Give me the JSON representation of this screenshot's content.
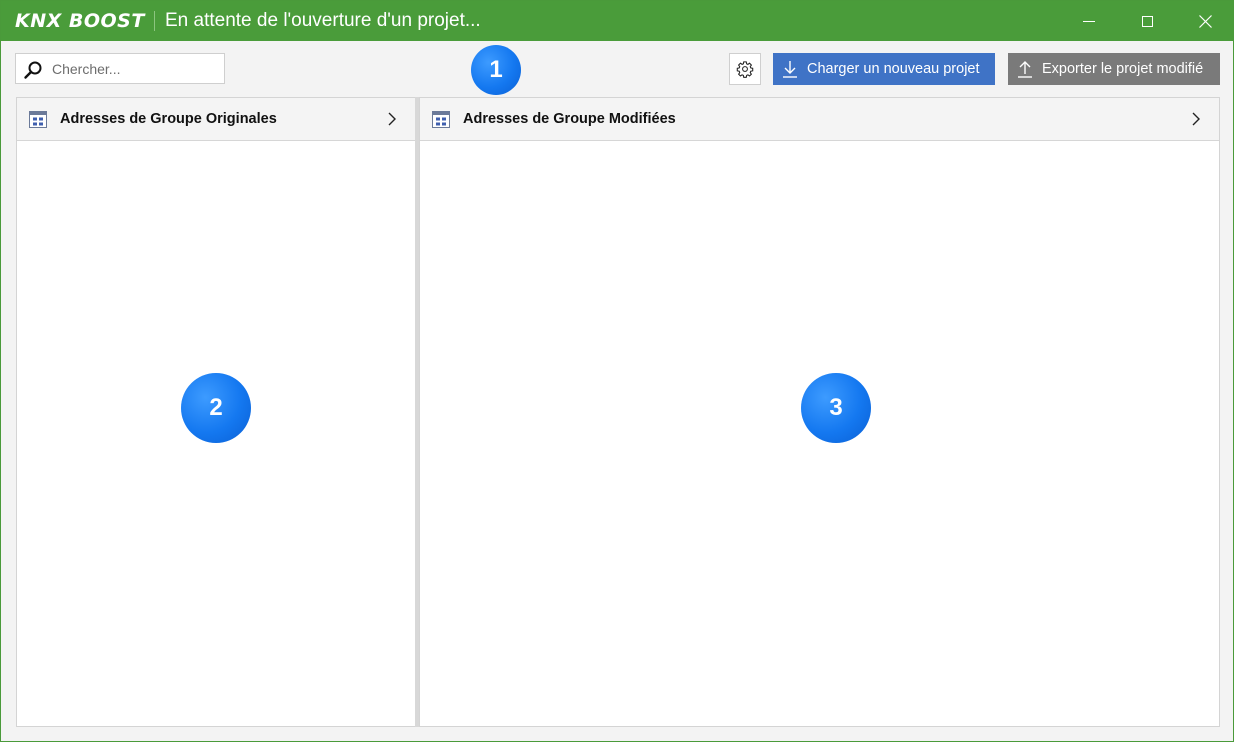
{
  "window": {
    "logo_text": "KNX BOOST",
    "title": "En attente de l'ouverture d'un projet...",
    "controls": {
      "minimize_icon": "minimize-icon",
      "maximize_icon": "maximize-icon",
      "close_icon": "close-icon"
    },
    "accent_color": "#4a9c3a"
  },
  "toolbar": {
    "search": {
      "placeholder": "Chercher...",
      "value": "",
      "icon": "search-icon"
    },
    "settings_icon": "gear-icon",
    "load_button": {
      "label": "Charger un nouveau projet",
      "icon": "download-arrow-icon",
      "color": "#3f73c6"
    },
    "export_button": {
      "label": "Exporter le projet modifié",
      "icon": "upload-arrow-icon",
      "color": "#7a7a7a"
    }
  },
  "badges": [
    "1",
    "2",
    "3"
  ],
  "panels": {
    "left": {
      "title": "Adresses de Groupe Originales",
      "icon": "table-icon",
      "chevron": "chevron-right-icon"
    },
    "right": {
      "title": "Adresses de Groupe Modifiées",
      "icon": "table-icon",
      "chevron": "chevron-right-icon"
    }
  }
}
